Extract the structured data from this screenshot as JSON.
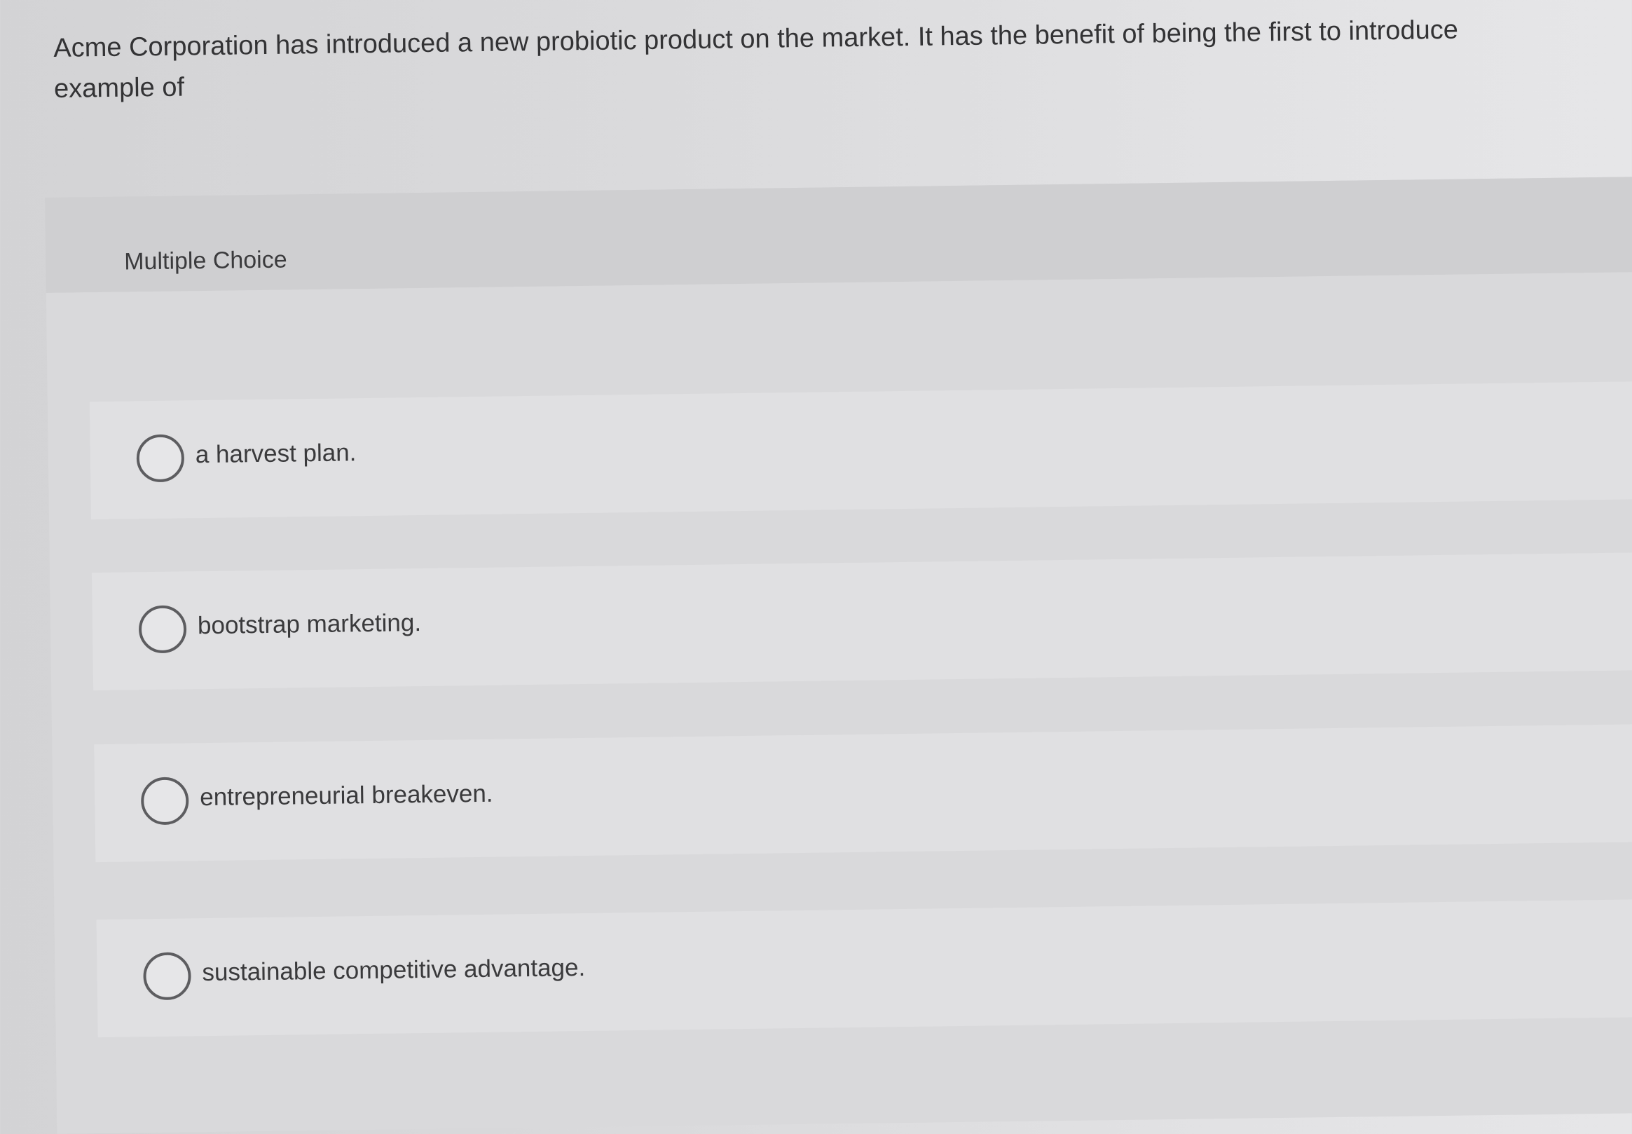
{
  "question": {
    "line1": "Acme Corporation has introduced a new probiotic product on the market. It has the benefit of being the first to introduce",
    "line2": "example of"
  },
  "multiple_choice": {
    "label": "Multiple Choice",
    "options": [
      {
        "text": "a harvest plan.",
        "selected": false
      },
      {
        "text": "bootstrap marketing.",
        "selected": false
      },
      {
        "text": "entrepreneurial breakeven.",
        "selected": false
      },
      {
        "text": "sustainable competitive advantage.",
        "selected": false
      }
    ]
  }
}
